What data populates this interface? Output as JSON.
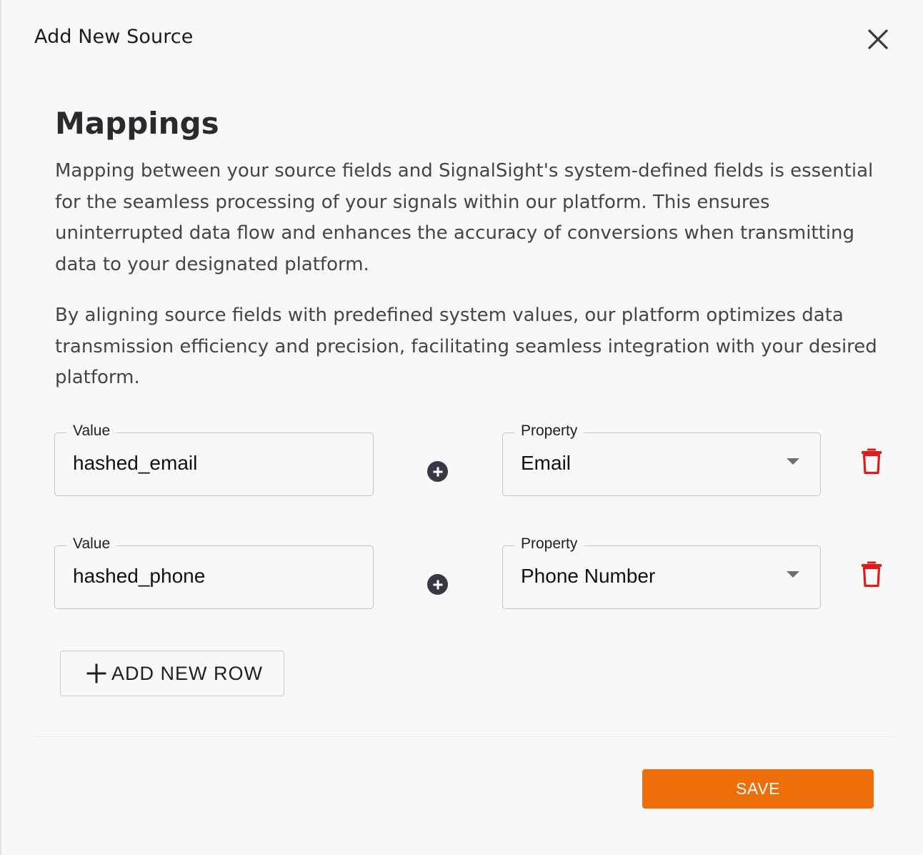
{
  "dialog": {
    "title": "Add New Source",
    "close_icon": "close-icon"
  },
  "section": {
    "heading": "Mappings",
    "paragraphs": [
      "Mapping between your source fields and SignalSight's system-defined fields is essential for the seamless processing of your signals within our platform. This ensures uninterrupted data flow and enhances the accuracy of conversions when transmitting data to your designated platform.",
      "By aligning source fields with predefined system values, our platform optimizes data transmission efficiency and precision, facilitating seamless integration with your desired platform."
    ]
  },
  "mappings": [
    {
      "value_label": "Value",
      "value": "hashed_email",
      "property_label": "Property",
      "property": "Email"
    },
    {
      "value_label": "Value",
      "value": "hashed_phone",
      "property_label": "Property",
      "property": "Phone Number"
    }
  ],
  "actions": {
    "add_row_label": "ADD NEW ROW",
    "save_label": "SAVE"
  },
  "colors": {
    "accent": "#ee6e09",
    "delete": "#e01b1b"
  },
  "icons": {
    "add_mapping": "plus-circle-icon",
    "delete_row": "trash-icon",
    "dropdown": "caret-down-icon",
    "add_row": "plus-icon"
  }
}
